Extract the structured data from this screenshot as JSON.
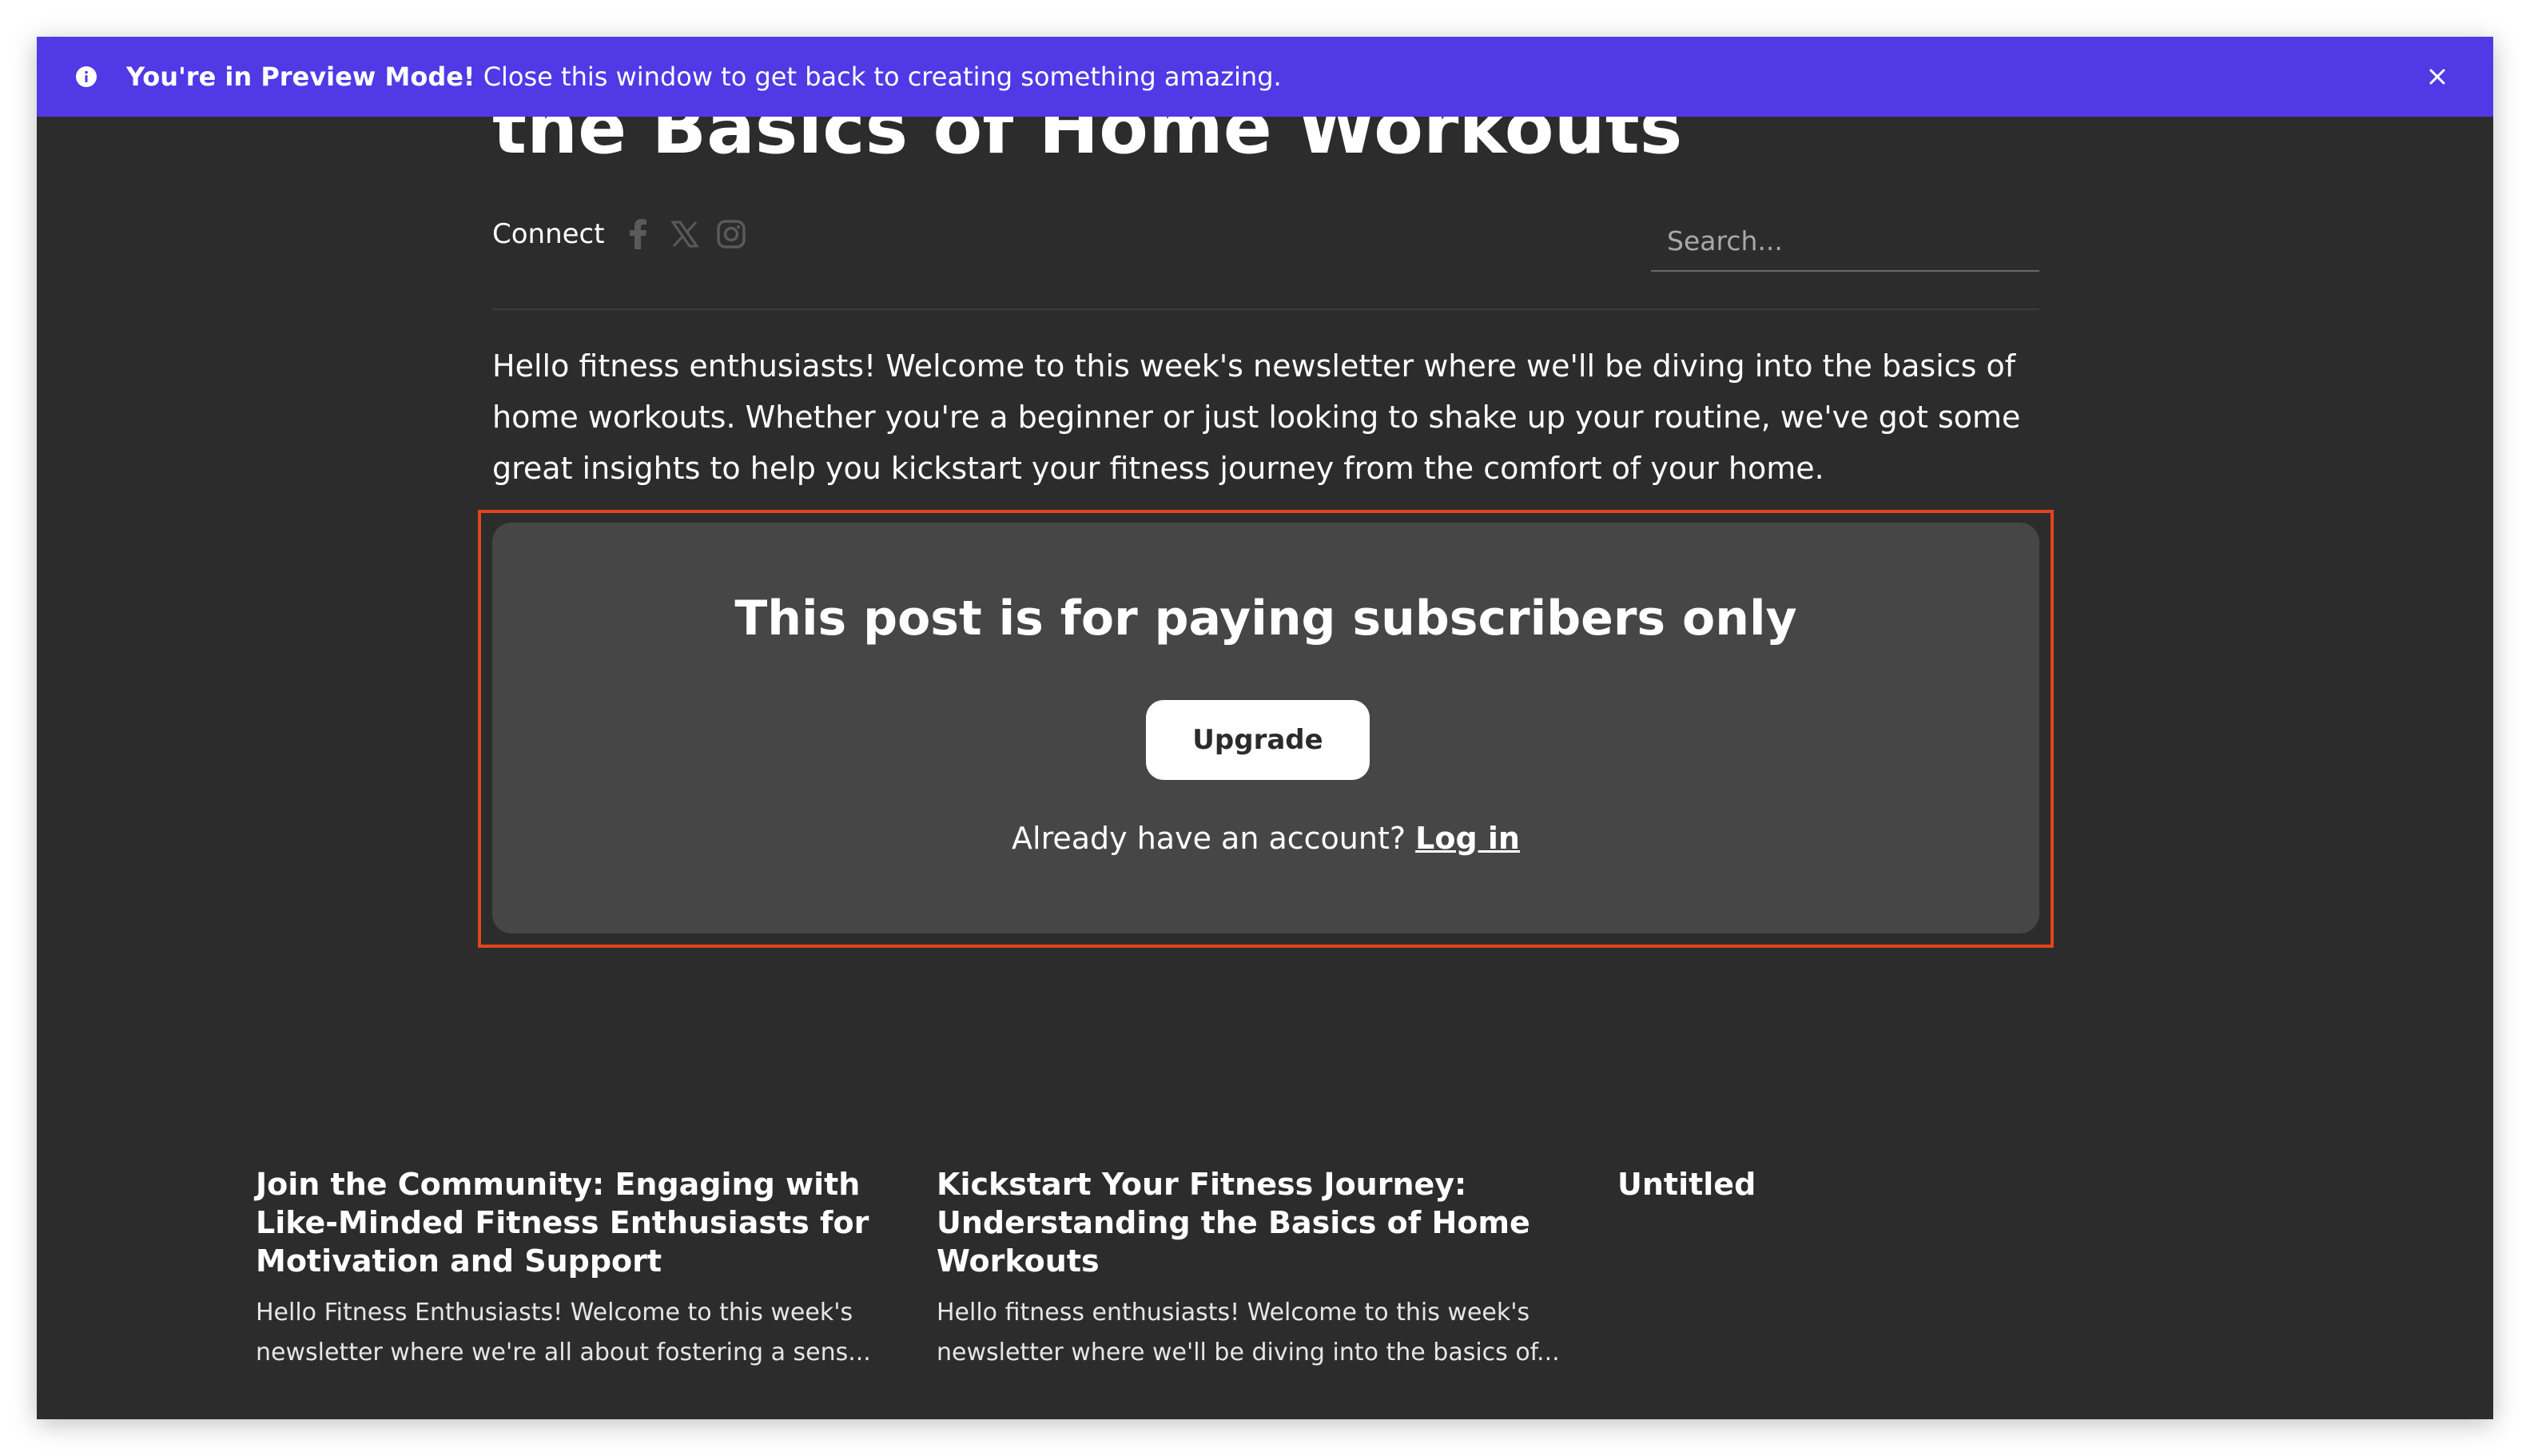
{
  "banner": {
    "strong_text": "You're in Preview Mode!",
    "text": " Close this window to get back to creating something amazing.",
    "icons": {
      "info": "info-icon",
      "close": "close-icon"
    }
  },
  "post": {
    "title": "the Basics of Home Workouts",
    "connect_label": "Connect",
    "social_icons": [
      "facebook-icon",
      "x-icon",
      "instagram-icon"
    ],
    "search_placeholder": "Search...",
    "intro": "Hello fitness enthusiasts! Welcome to this week's newsletter where we'll be diving into the basics of home workouts. Whether you're a beginner or just looking to shake up your routine, we've got some great insights to help you kickstart your fitness journey from the comfort of your home."
  },
  "paywall": {
    "title": "This post is for paying subscribers only",
    "upgrade_label": "Upgrade",
    "account_prompt": "Already have an account? ",
    "login_label": "Log in"
  },
  "related": [
    {
      "title": "Join the Community: Engaging with Like-Minded Fitness Enthusiasts for Motivation and Support",
      "excerpt": "Hello Fitness Enthusiasts! Welcome to this week's newsletter where we're all about fostering a sens..."
    },
    {
      "title": "Kickstart Your Fitness Journey: Understanding the Basics of Home Workouts",
      "excerpt": "Hello fitness enthusiasts! Welcome to this week's newsletter where we'll be diving into the basics of..."
    },
    {
      "title": "Untitled",
      "excerpt": ""
    }
  ],
  "colors": {
    "banner_bg": "#5239e6",
    "page_bg": "#2c2c2c",
    "paywall_bg": "#464646",
    "highlight_border": "#e0451e"
  }
}
